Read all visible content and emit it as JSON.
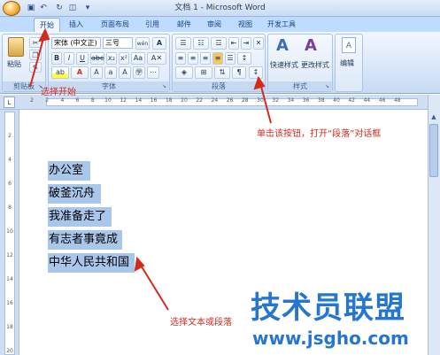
{
  "window": {
    "title": "文档 1 - Microsoft Word"
  },
  "quick_access": [
    "save",
    "undo",
    "redo",
    "print-preview",
    "customize"
  ],
  "tabs": [
    {
      "label": "开始",
      "active": true
    },
    {
      "label": "插入"
    },
    {
      "label": "页面布局"
    },
    {
      "label": "引用"
    },
    {
      "label": "邮件"
    },
    {
      "label": "审阅"
    },
    {
      "label": "视图"
    },
    {
      "label": "开发工具"
    }
  ],
  "ribbon": {
    "clipboard": {
      "label": "剪贴板",
      "paste_label": "粘贴"
    },
    "font": {
      "label": "字体",
      "font_name": "宋体 (中文正)",
      "font_size": "三号",
      "wen_label": "wén"
    },
    "paragraph": {
      "label": "段落"
    },
    "styles": {
      "label": "样式",
      "quick_styles": "快速样式",
      "change_styles": "更改样式"
    },
    "editing": {
      "label": "编辑"
    }
  },
  "ruler": {
    "numbers": [
      "2",
      "2",
      "4",
      "6",
      "8",
      "10",
      "12",
      "14",
      "16",
      "18",
      "20",
      "22",
      "24",
      "26",
      "28",
      "30",
      "32",
      "34",
      "36",
      "38",
      "40",
      "42",
      "44",
      "46",
      "48"
    ],
    "vnumbers": [
      "2",
      "4",
      "6",
      "8",
      "10",
      "12",
      "14",
      "16",
      "18",
      "20"
    ]
  },
  "document": {
    "lines": [
      "办公室",
      "破釜沉舟",
      "我准备走了",
      "有志者事竟成",
      "中华人民共和国"
    ]
  },
  "annotations": {
    "select_start": "选择开始",
    "click_button": "单击该按钮，打开“段落”对话框",
    "select_text": "选择文本或段落"
  },
  "watermark": {
    "text": "技术员联盟",
    "url": "www.jsgho.com"
  },
  "colors": {
    "annotation": "#d42a1b",
    "selection": "#a9c7eb",
    "watermark": "#2676d0"
  }
}
